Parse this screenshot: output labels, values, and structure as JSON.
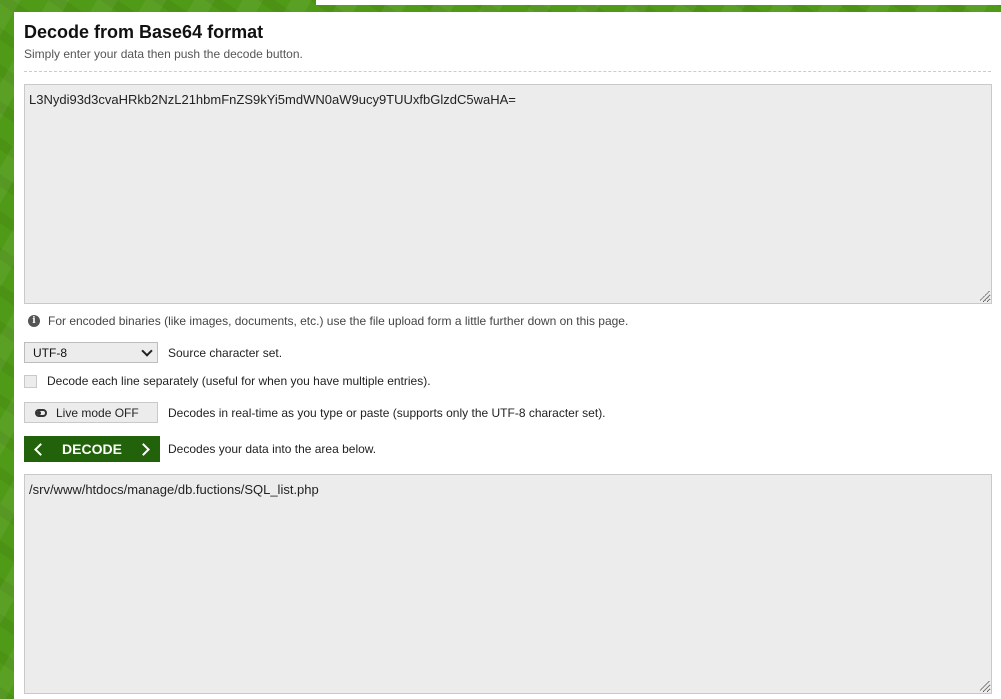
{
  "header": {
    "title": "Decode from Base64 format",
    "subtitle": "Simply enter your data then push the decode button."
  },
  "input": {
    "value": "L3Nydi93d3cvaHRkb2NzL21hbmFnZS9kYi5mdWN0aW9ucy9TUUxfbGlzdC5waHA="
  },
  "hint": {
    "text": "For encoded binaries (like images, documents, etc.) use the file upload form a little further down on this page."
  },
  "charset": {
    "selected": "UTF-8",
    "label": "Source character set."
  },
  "lines": {
    "label": "Decode each line separately (useful for when you have multiple entries)."
  },
  "live": {
    "button_label": "Live mode OFF",
    "description": "Decodes in real-time as you type or paste (supports only the UTF-8 character set)."
  },
  "decode": {
    "button_label": "DECODE",
    "description": "Decodes your data into the area below."
  },
  "output": {
    "value": "/srv/www/htdocs/manage/db.fuctions/SQL_list.php"
  },
  "icons": {
    "info": "info-icon",
    "toggle": "toggle-icon",
    "select": "chevron-down-icon",
    "decode_left": "chevron-left-icon",
    "decode_right": "chevron-right-icon"
  },
  "colors": {
    "background": "#4f9a16",
    "decode_button": "#22620a",
    "field_bg": "#ececec"
  }
}
